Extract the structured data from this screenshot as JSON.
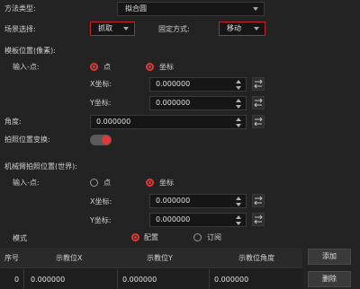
{
  "method": {
    "label": "方法类型:",
    "value": "拟合圆"
  },
  "scene": {
    "label": "场景选择:",
    "value": "抓取"
  },
  "fixed_mode": {
    "label": "固定方式:",
    "value": "移动"
  },
  "template_section": {
    "title": "模板位置(像素):"
  },
  "template_input": {
    "label": "输入-点:",
    "options": [
      "点",
      "坐标"
    ],
    "x_label": "X坐标:",
    "x_value": "0.000000",
    "y_label": "Y坐标:",
    "y_value": "0.000000"
  },
  "angle": {
    "label": "角度:",
    "value": "0.000000"
  },
  "photo_transform": {
    "label": "拍照位置变换:",
    "enabled": true
  },
  "robot_section": {
    "title": "机械臂拍照位置(世界):"
  },
  "robot_input": {
    "label": "输入-点:",
    "options": [
      "点",
      "坐标"
    ],
    "x_label": "X坐标:",
    "x_value": "0.000000",
    "y_label": "Y坐标:",
    "y_value": "0.000000"
  },
  "mode": {
    "label": "模式",
    "options": [
      "配置",
      "订阅"
    ],
    "selected": "配置"
  },
  "table": {
    "headers": [
      "序号",
      "示教位X",
      "示教位Y",
      "示教位角度"
    ],
    "rows": [
      [
        "0",
        "0.000000",
        "0.000000",
        "0.000000"
      ]
    ]
  },
  "buttons": {
    "add": "添加",
    "delete": "删除"
  },
  "colors": {
    "accent": "#e8353a",
    "background": "#232323",
    "field": "#161616"
  }
}
